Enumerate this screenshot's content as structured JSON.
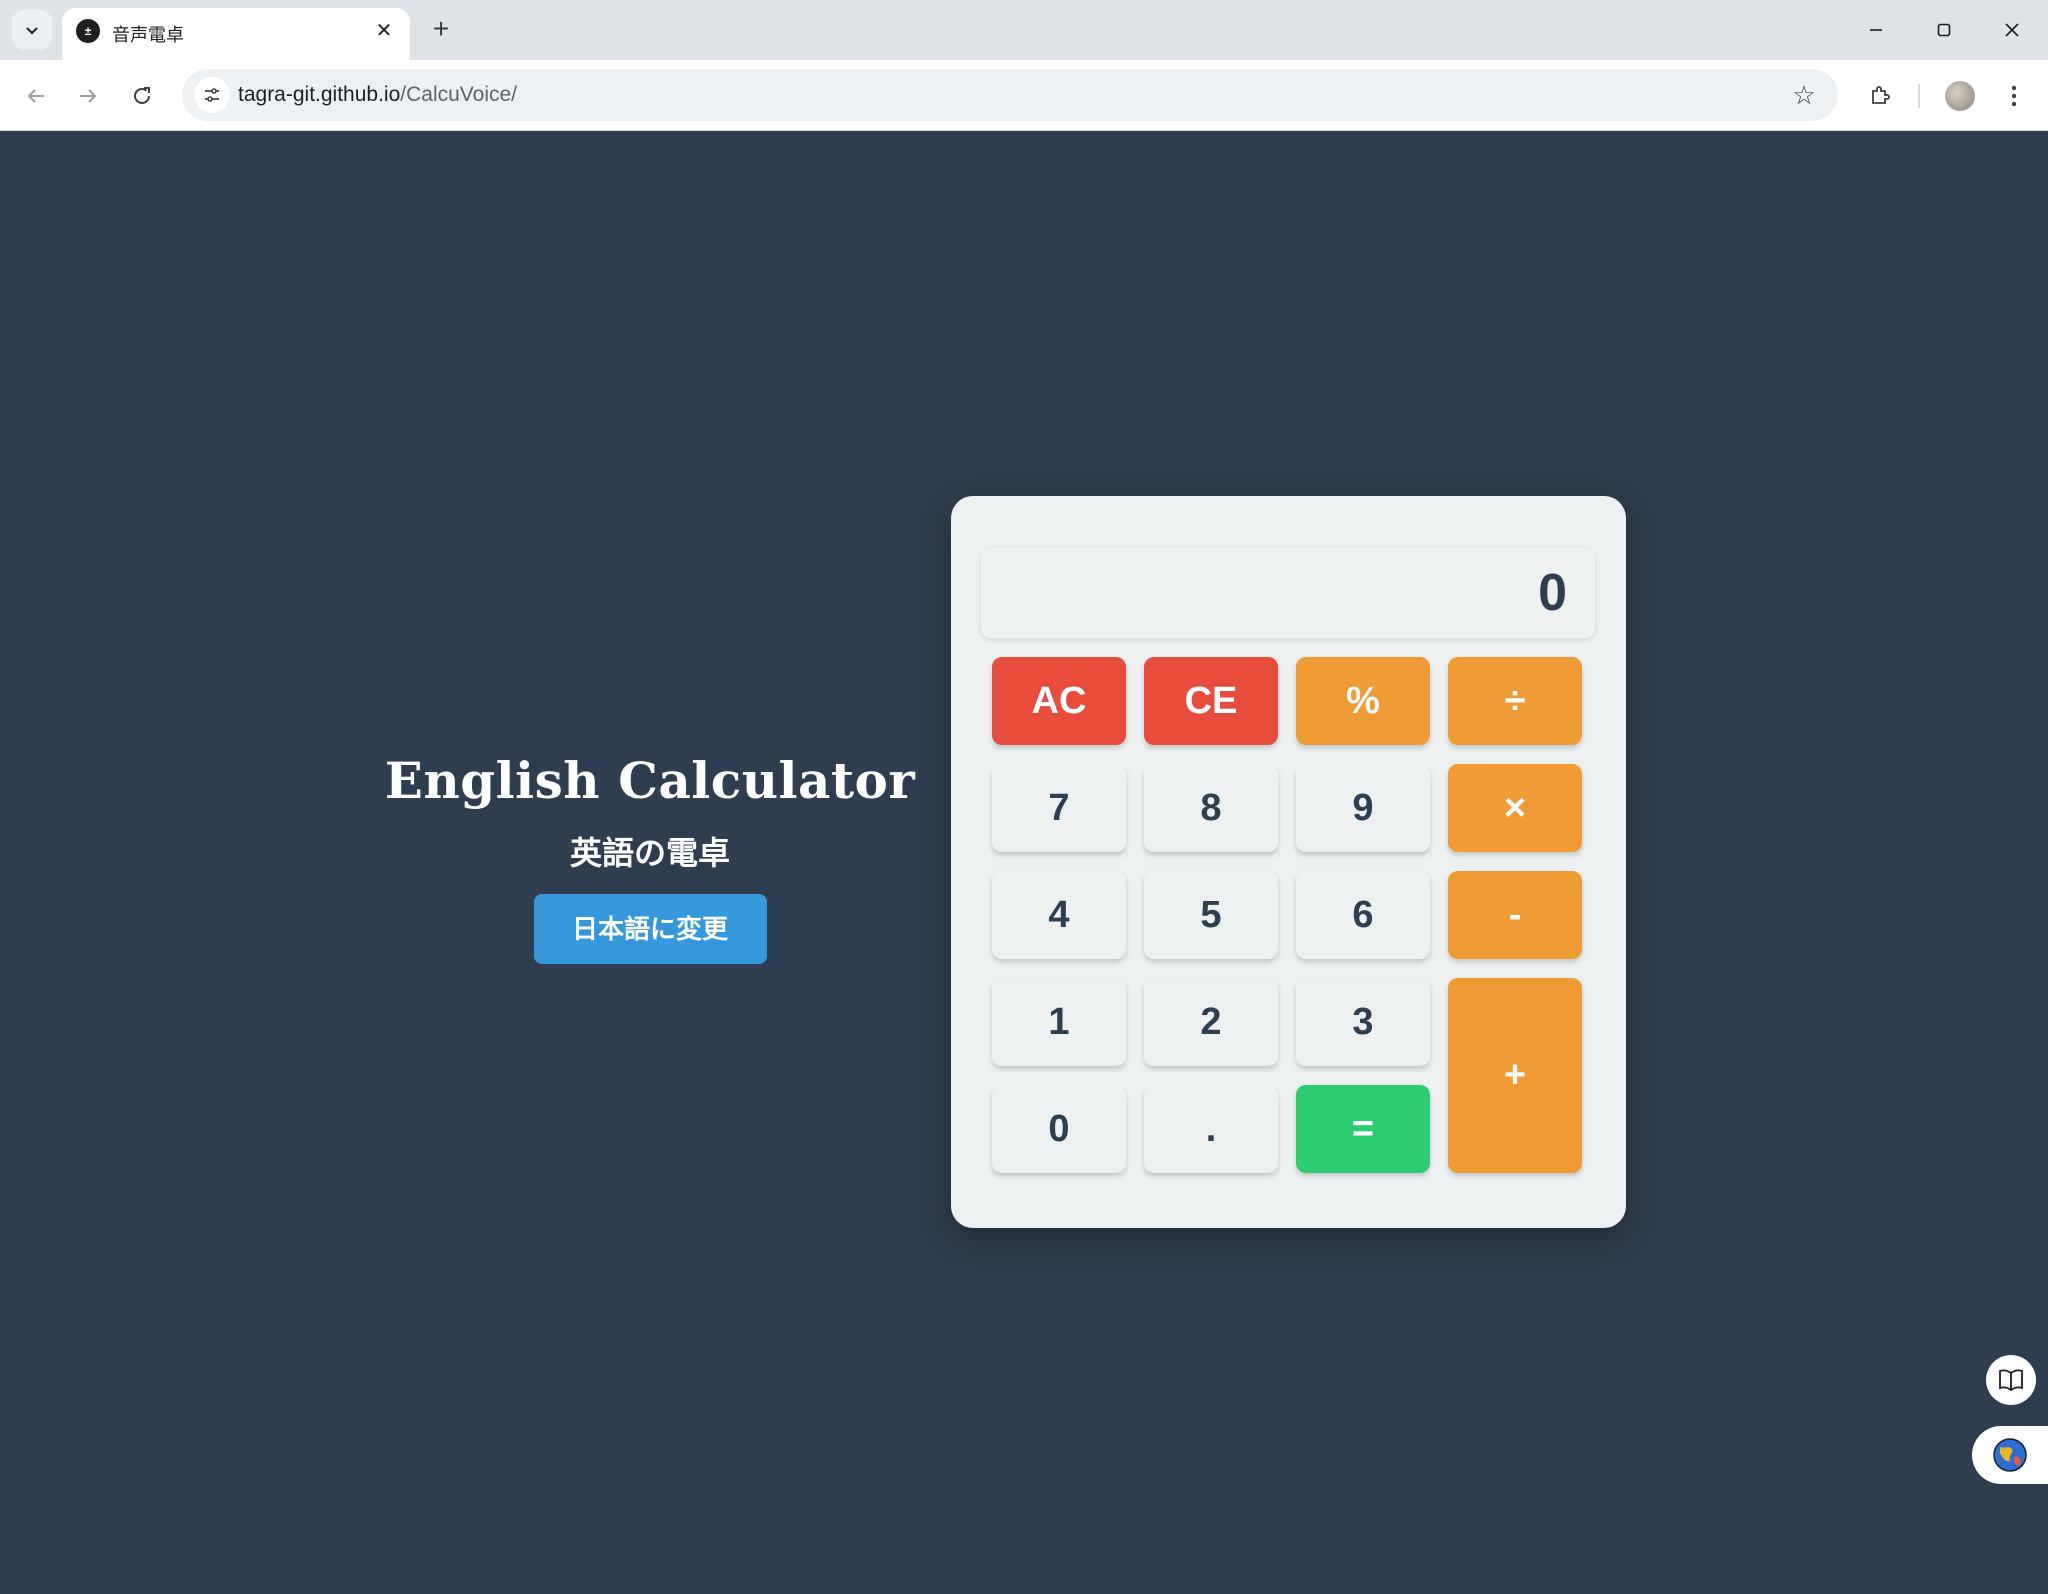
{
  "browser": {
    "tab_title": "音声電卓",
    "url_host": "tagra-git.github.io",
    "url_path": "/CalcuVoice/"
  },
  "intro": {
    "title": "English Calculator",
    "subtitle": "英語の電卓",
    "switch_button": "日本語に変更"
  },
  "calculator": {
    "display": "0",
    "keys": [
      "AC",
      "CE",
      "%",
      "÷",
      "7",
      "8",
      "9",
      "×",
      "4",
      "5",
      "6",
      "-",
      "1",
      "2",
      "3",
      "+",
      "0",
      ".",
      "="
    ]
  },
  "colors": {
    "background": "#2e3d4f",
    "clear_keys": "#e74c3c",
    "operator_keys": "#f09c34",
    "equals_key": "#2ecc71",
    "language_button": "#3498db"
  }
}
